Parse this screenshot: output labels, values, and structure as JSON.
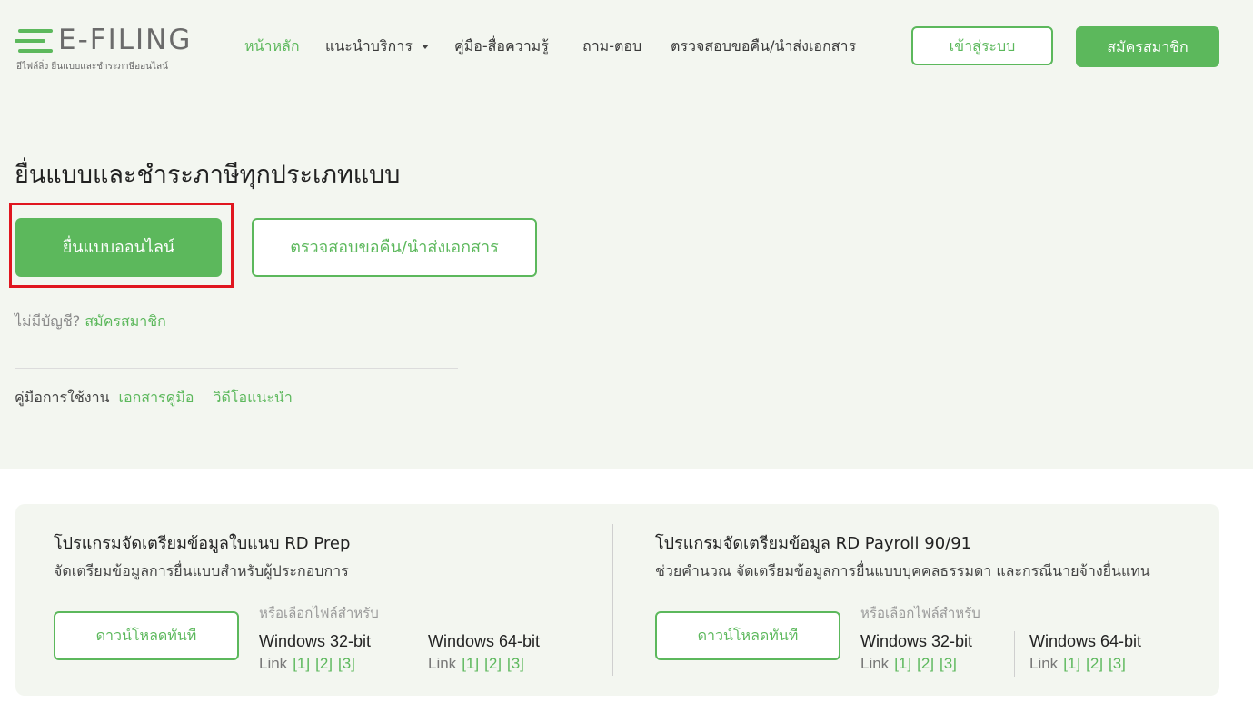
{
  "logo": {
    "text": "E-FILING",
    "tagline": "อีไฟล์ลิ่ง ยื่นแบบและชำระภาษีออนไลน์"
  },
  "nav": {
    "items": [
      {
        "label": "หน้าหลัก"
      },
      {
        "label": "แนะนำบริการ"
      },
      {
        "label": "คู่มือ-สื่อความรู้"
      },
      {
        "label": "ถาม-ตอบ"
      },
      {
        "label": "ตรวจสอบขอคืน/นำส่งเอกสาร"
      }
    ],
    "login_label": "เข้าสู่ระบบ",
    "register_label": "สมัครสมาชิก"
  },
  "hero": {
    "title": "ยื่นแบบและชำระภาษีทุกประเภทแบบ",
    "file_online_label": "ยื่นแบบออนไลน์",
    "check_refund_label": "ตรวจสอบขอคืน/นำส่งเอกสาร",
    "no_account_text": "ไม่มีบัญชี?",
    "no_account_link": "สมัครสมาชิก",
    "manual_text": "คู่มือการใช้งาน",
    "manual_doc_link": "เอกสารคู่มือ",
    "manual_video_link": "วิดีโอแนะนำ"
  },
  "downloads": [
    {
      "title": "โปรแกรมจัดเตรียมข้อมูลใบแนบ RD Prep",
      "subtitle": "จัดเตรียมข้อมูลการยื่นแบบสำหรับผู้ประกอบการ",
      "button_label": "ดาวน์โหลดทันที",
      "or_choose": "หรือเลือกไฟล์สำหรับ",
      "os": [
        {
          "name": "Windows 32-bit",
          "link_label": "Link",
          "links": [
            "[1]",
            "[2]",
            "[3]"
          ]
        },
        {
          "name": "Windows 64-bit",
          "link_label": "Link",
          "links": [
            "[1]",
            "[2]",
            "[3]"
          ]
        }
      ]
    },
    {
      "title": "โปรแกรมจัดเตรียมข้อมูล RD Payroll 90/91",
      "subtitle": "ช่วยคำนวณ จัดเตรียมข้อมูลการยื่นแบบบุคคลธรรมดา และกรณีนายจ้างยื่นแทน",
      "button_label": "ดาวน์โหลดทันที",
      "or_choose": "หรือเลือกไฟล์สำหรับ",
      "os": [
        {
          "name": "Windows 32-bit",
          "link_label": "Link",
          "links": [
            "[1]",
            "[2]",
            "[3]"
          ]
        },
        {
          "name": "Windows 64-bit",
          "link_label": "Link",
          "links": [
            "[1]",
            "[2]",
            "[3]"
          ]
        }
      ]
    }
  ],
  "colors": {
    "accent": "#5cb85c",
    "highlight": "#e0161f",
    "hero_bg": "#f3f6f0",
    "text": "#222222"
  },
  "icons": {
    "nav_dropdown": "caret-down-icon"
  }
}
